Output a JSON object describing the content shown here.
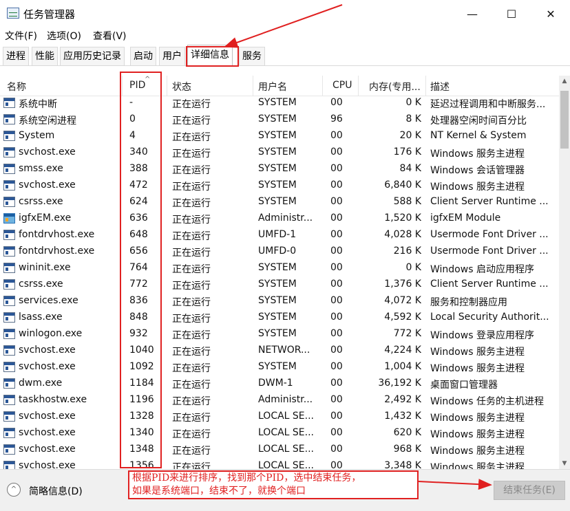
{
  "window": {
    "title": "任务管理器",
    "minimize": "—",
    "maximize": "☐",
    "close": "✕"
  },
  "menu": [
    "文件(F)",
    "选项(O)",
    "查看(V)"
  ],
  "tabs": [
    "进程",
    "性能",
    "应用历史记录",
    "启动",
    "用户",
    "详细信息",
    "服务"
  ],
  "active_tab": "详细信息",
  "columns": [
    "名称",
    "PID",
    "状态",
    "用户名",
    "CPU",
    "内存(专用...",
    "描述"
  ],
  "sort": {
    "column": "PID",
    "direction": "ascending",
    "indicator": "^"
  },
  "rows": [
    {
      "icon": "system-process-icon",
      "name": "系统中断",
      "pid": "-",
      "status": "正在运行",
      "user": "SYSTEM",
      "cpu": "00",
      "mem": "0 K",
      "desc": "延迟过程调用和中断服务..."
    },
    {
      "icon": "system-process-icon",
      "name": "系统空闲进程",
      "pid": "0",
      "status": "正在运行",
      "user": "SYSTEM",
      "cpu": "96",
      "mem": "8 K",
      "desc": "处理器空闲时间百分比"
    },
    {
      "icon": "system-process-icon",
      "name": "System",
      "pid": "4",
      "status": "正在运行",
      "user": "SYSTEM",
      "cpu": "00",
      "mem": "20 K",
      "desc": "NT Kernel & System"
    },
    {
      "icon": "system-process-icon",
      "name": "svchost.exe",
      "pid": "340",
      "status": "正在运行",
      "user": "SYSTEM",
      "cpu": "00",
      "mem": "176 K",
      "desc": "Windows 服务主进程"
    },
    {
      "icon": "system-process-icon",
      "name": "smss.exe",
      "pid": "388",
      "status": "正在运行",
      "user": "SYSTEM",
      "cpu": "00",
      "mem": "84 K",
      "desc": "Windows 会话管理器"
    },
    {
      "icon": "system-process-icon",
      "name": "svchost.exe",
      "pid": "472",
      "status": "正在运行",
      "user": "SYSTEM",
      "cpu": "00",
      "mem": "6,840 K",
      "desc": "Windows 服务主进程"
    },
    {
      "icon": "system-process-icon",
      "name": "csrss.exe",
      "pid": "624",
      "status": "正在运行",
      "user": "SYSTEM",
      "cpu": "00",
      "mem": "588 K",
      "desc": "Client Server Runtime ..."
    },
    {
      "icon": "igfx-process-icon",
      "name": "igfxEM.exe",
      "pid": "636",
      "status": "正在运行",
      "user": "Administr...",
      "cpu": "00",
      "mem": "1,520 K",
      "desc": "igfxEM Module"
    },
    {
      "icon": "system-process-icon",
      "name": "fontdrvhost.exe",
      "pid": "648",
      "status": "正在运行",
      "user": "UMFD-1",
      "cpu": "00",
      "mem": "4,028 K",
      "desc": "Usermode Font Driver ..."
    },
    {
      "icon": "system-process-icon",
      "name": "fontdrvhost.exe",
      "pid": "656",
      "status": "正在运行",
      "user": "UMFD-0",
      "cpu": "00",
      "mem": "216 K",
      "desc": "Usermode Font Driver ..."
    },
    {
      "icon": "system-process-icon",
      "name": "wininit.exe",
      "pid": "764",
      "status": "正在运行",
      "user": "SYSTEM",
      "cpu": "00",
      "mem": "0 K",
      "desc": "Windows 启动应用程序"
    },
    {
      "icon": "system-process-icon",
      "name": "csrss.exe",
      "pid": "772",
      "status": "正在运行",
      "user": "SYSTEM",
      "cpu": "00",
      "mem": "1,376 K",
      "desc": "Client Server Runtime ..."
    },
    {
      "icon": "system-process-icon",
      "name": "services.exe",
      "pid": "836",
      "status": "正在运行",
      "user": "SYSTEM",
      "cpu": "00",
      "mem": "4,072 K",
      "desc": "服务和控制器应用"
    },
    {
      "icon": "system-process-icon",
      "name": "lsass.exe",
      "pid": "848",
      "status": "正在运行",
      "user": "SYSTEM",
      "cpu": "00",
      "mem": "4,592 K",
      "desc": "Local Security Authorit..."
    },
    {
      "icon": "system-process-icon",
      "name": "winlogon.exe",
      "pid": "932",
      "status": "正在运行",
      "user": "SYSTEM",
      "cpu": "00",
      "mem": "772 K",
      "desc": "Windows 登录应用程序"
    },
    {
      "icon": "system-process-icon",
      "name": "svchost.exe",
      "pid": "1040",
      "status": "正在运行",
      "user": "NETWOR...",
      "cpu": "00",
      "mem": "4,224 K",
      "desc": "Windows 服务主进程"
    },
    {
      "icon": "system-process-icon",
      "name": "svchost.exe",
      "pid": "1092",
      "status": "正在运行",
      "user": "SYSTEM",
      "cpu": "00",
      "mem": "1,004 K",
      "desc": "Windows 服务主进程"
    },
    {
      "icon": "system-process-icon",
      "name": "dwm.exe",
      "pid": "1184",
      "status": "正在运行",
      "user": "DWM-1",
      "cpu": "00",
      "mem": "36,192 K",
      "desc": "桌面窗口管理器"
    },
    {
      "icon": "system-process-icon",
      "name": "taskhostw.exe",
      "pid": "1196",
      "status": "正在运行",
      "user": "Administr...",
      "cpu": "00",
      "mem": "2,492 K",
      "desc": "Windows 任务的主机进程"
    },
    {
      "icon": "system-process-icon",
      "name": "svchost.exe",
      "pid": "1328",
      "status": "正在运行",
      "user": "LOCAL SE...",
      "cpu": "00",
      "mem": "1,432 K",
      "desc": "Windows 服务主进程"
    },
    {
      "icon": "system-process-icon",
      "name": "svchost.exe",
      "pid": "1340",
      "status": "正在运行",
      "user": "LOCAL SE...",
      "cpu": "00",
      "mem": "620 K",
      "desc": "Windows 服务主进程"
    },
    {
      "icon": "system-process-icon",
      "name": "svchost.exe",
      "pid": "1348",
      "status": "正在运行",
      "user": "LOCAL SE...",
      "cpu": "00",
      "mem": "968 K",
      "desc": "Windows 服务主进程"
    },
    {
      "icon": "system-process-icon",
      "name": "svchost.exe",
      "pid": "1356",
      "status": "正在运行",
      "user": "LOCAL SE...",
      "cpu": "00",
      "mem": "3,348 K",
      "desc": "Windows 服务主进程"
    }
  ],
  "footer": {
    "brief_label": "简略信息(D)",
    "brief_icon": "^",
    "end_task_label": "结束任务(E)"
  },
  "annotation": {
    "lines": [
      "根据PID来进行排序，找到那个PID，选中结束任务，",
      "如果是系统端口，结束不了，就换个端口"
    ],
    "color": "#e02020"
  },
  "scrollbar": {
    "up": "▲",
    "down": "▼"
  }
}
